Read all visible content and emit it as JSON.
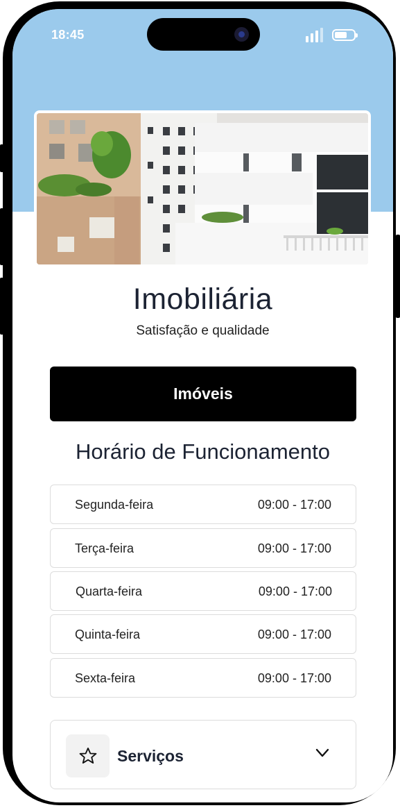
{
  "status_bar": {
    "time": "18:45"
  },
  "header": {
    "title": "Imobiliária",
    "subtitle": "Satisfação e qualidade"
  },
  "main_button": {
    "label": "Imóveis"
  },
  "hours": {
    "title": "Horário de Funcionamento",
    "rows": [
      {
        "day": "Segunda-feira",
        "hours": "09:00 - 17:00"
      },
      {
        "day": "Terça-feira",
        "hours": "09:00 - 17:00"
      },
      {
        "day": "Quarta-feira",
        "hours": "09:00 - 17:00"
      },
      {
        "day": "Quinta-feira",
        "hours": "09:00 - 17:00"
      },
      {
        "day": "Sexta-feira",
        "hours": "09:00 - 17:00"
      }
    ]
  },
  "services": {
    "label": "Serviços",
    "icon": "star-icon",
    "toggle_icon": "chevron-down-icon"
  },
  "colors": {
    "header_bg": "#9bcaec",
    "primary_button": "#000000",
    "text_dark": "#1c2333"
  }
}
